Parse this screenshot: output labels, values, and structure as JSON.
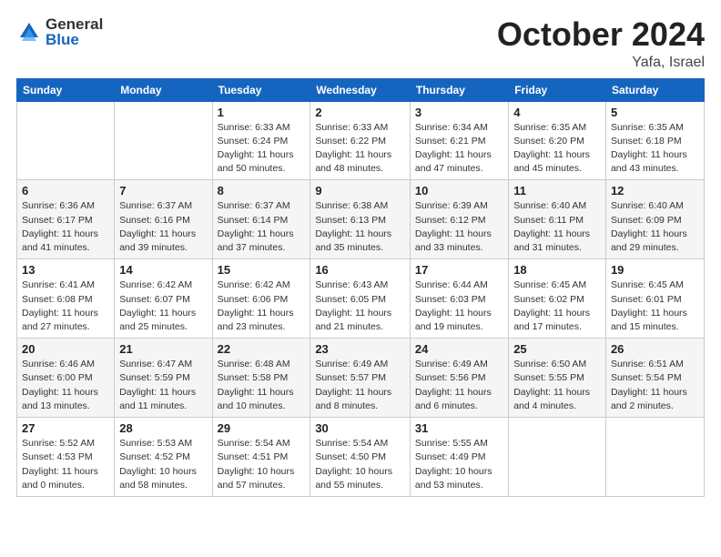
{
  "logo": {
    "general": "General",
    "blue": "Blue"
  },
  "header": {
    "month": "October 2024",
    "location": "Yafa, Israel"
  },
  "weekdays": [
    "Sunday",
    "Monday",
    "Tuesday",
    "Wednesday",
    "Thursday",
    "Friday",
    "Saturday"
  ],
  "weeks": [
    [
      {
        "day": "",
        "info": ""
      },
      {
        "day": "",
        "info": ""
      },
      {
        "day": "1",
        "info": "Sunrise: 6:33 AM\nSunset: 6:24 PM\nDaylight: 11 hours and 50 minutes."
      },
      {
        "day": "2",
        "info": "Sunrise: 6:33 AM\nSunset: 6:22 PM\nDaylight: 11 hours and 48 minutes."
      },
      {
        "day": "3",
        "info": "Sunrise: 6:34 AM\nSunset: 6:21 PM\nDaylight: 11 hours and 47 minutes."
      },
      {
        "day": "4",
        "info": "Sunrise: 6:35 AM\nSunset: 6:20 PM\nDaylight: 11 hours and 45 minutes."
      },
      {
        "day": "5",
        "info": "Sunrise: 6:35 AM\nSunset: 6:18 PM\nDaylight: 11 hours and 43 minutes."
      }
    ],
    [
      {
        "day": "6",
        "info": "Sunrise: 6:36 AM\nSunset: 6:17 PM\nDaylight: 11 hours and 41 minutes."
      },
      {
        "day": "7",
        "info": "Sunrise: 6:37 AM\nSunset: 6:16 PM\nDaylight: 11 hours and 39 minutes."
      },
      {
        "day": "8",
        "info": "Sunrise: 6:37 AM\nSunset: 6:14 PM\nDaylight: 11 hours and 37 minutes."
      },
      {
        "day": "9",
        "info": "Sunrise: 6:38 AM\nSunset: 6:13 PM\nDaylight: 11 hours and 35 minutes."
      },
      {
        "day": "10",
        "info": "Sunrise: 6:39 AM\nSunset: 6:12 PM\nDaylight: 11 hours and 33 minutes."
      },
      {
        "day": "11",
        "info": "Sunrise: 6:40 AM\nSunset: 6:11 PM\nDaylight: 11 hours and 31 minutes."
      },
      {
        "day": "12",
        "info": "Sunrise: 6:40 AM\nSunset: 6:09 PM\nDaylight: 11 hours and 29 minutes."
      }
    ],
    [
      {
        "day": "13",
        "info": "Sunrise: 6:41 AM\nSunset: 6:08 PM\nDaylight: 11 hours and 27 minutes."
      },
      {
        "day": "14",
        "info": "Sunrise: 6:42 AM\nSunset: 6:07 PM\nDaylight: 11 hours and 25 minutes."
      },
      {
        "day": "15",
        "info": "Sunrise: 6:42 AM\nSunset: 6:06 PM\nDaylight: 11 hours and 23 minutes."
      },
      {
        "day": "16",
        "info": "Sunrise: 6:43 AM\nSunset: 6:05 PM\nDaylight: 11 hours and 21 minutes."
      },
      {
        "day": "17",
        "info": "Sunrise: 6:44 AM\nSunset: 6:03 PM\nDaylight: 11 hours and 19 minutes."
      },
      {
        "day": "18",
        "info": "Sunrise: 6:45 AM\nSunset: 6:02 PM\nDaylight: 11 hours and 17 minutes."
      },
      {
        "day": "19",
        "info": "Sunrise: 6:45 AM\nSunset: 6:01 PM\nDaylight: 11 hours and 15 minutes."
      }
    ],
    [
      {
        "day": "20",
        "info": "Sunrise: 6:46 AM\nSunset: 6:00 PM\nDaylight: 11 hours and 13 minutes."
      },
      {
        "day": "21",
        "info": "Sunrise: 6:47 AM\nSunset: 5:59 PM\nDaylight: 11 hours and 11 minutes."
      },
      {
        "day": "22",
        "info": "Sunrise: 6:48 AM\nSunset: 5:58 PM\nDaylight: 11 hours and 10 minutes."
      },
      {
        "day": "23",
        "info": "Sunrise: 6:49 AM\nSunset: 5:57 PM\nDaylight: 11 hours and 8 minutes."
      },
      {
        "day": "24",
        "info": "Sunrise: 6:49 AM\nSunset: 5:56 PM\nDaylight: 11 hours and 6 minutes."
      },
      {
        "day": "25",
        "info": "Sunrise: 6:50 AM\nSunset: 5:55 PM\nDaylight: 11 hours and 4 minutes."
      },
      {
        "day": "26",
        "info": "Sunrise: 6:51 AM\nSunset: 5:54 PM\nDaylight: 11 hours and 2 minutes."
      }
    ],
    [
      {
        "day": "27",
        "info": "Sunrise: 5:52 AM\nSunset: 4:53 PM\nDaylight: 11 hours and 0 minutes."
      },
      {
        "day": "28",
        "info": "Sunrise: 5:53 AM\nSunset: 4:52 PM\nDaylight: 10 hours and 58 minutes."
      },
      {
        "day": "29",
        "info": "Sunrise: 5:54 AM\nSunset: 4:51 PM\nDaylight: 10 hours and 57 minutes."
      },
      {
        "day": "30",
        "info": "Sunrise: 5:54 AM\nSunset: 4:50 PM\nDaylight: 10 hours and 55 minutes."
      },
      {
        "day": "31",
        "info": "Sunrise: 5:55 AM\nSunset: 4:49 PM\nDaylight: 10 hours and 53 minutes."
      },
      {
        "day": "",
        "info": ""
      },
      {
        "day": "",
        "info": ""
      }
    ]
  ]
}
